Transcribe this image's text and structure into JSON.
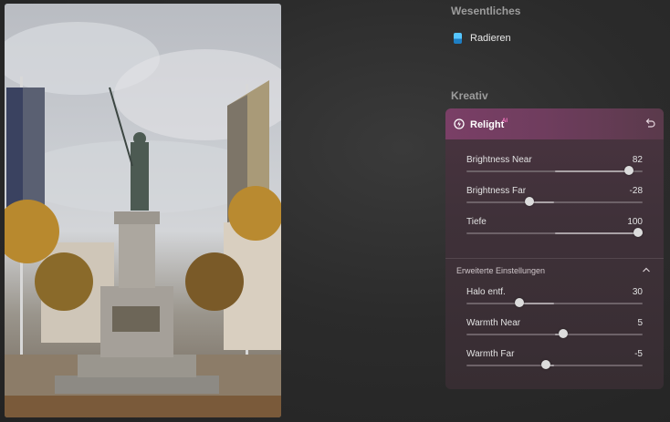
{
  "sections": {
    "essentials_title": "Wesentliches",
    "creative_title": "Kreativ"
  },
  "essentials": {
    "tool": {
      "label": "Radieren",
      "icon": "eraser-icon"
    }
  },
  "relight_panel": {
    "title": "Relight",
    "badge": "AI",
    "header_icon": "relight-icon",
    "reset_icon": "undo-icon",
    "accent_color": "#7a3f66",
    "sliders": [
      {
        "label": "Brightness Near",
        "value": "82",
        "level": 0.92
      },
      {
        "label": "Brightness Far",
        "value": "-28",
        "level": 0.36
      },
      {
        "label": "Tiefe",
        "value": "100",
        "level": 1.0
      }
    ],
    "advanced": {
      "title": "Erweiterte Einstellungen",
      "icon": "chevron-up-icon",
      "sliders": [
        {
          "label": "Halo entf.",
          "value": "30",
          "level": 0.3
        },
        {
          "label": "Warmth Near",
          "value": "5",
          "level": 0.55
        },
        {
          "label": "Warmth Far",
          "value": "-5",
          "level": 0.45
        }
      ]
    }
  }
}
